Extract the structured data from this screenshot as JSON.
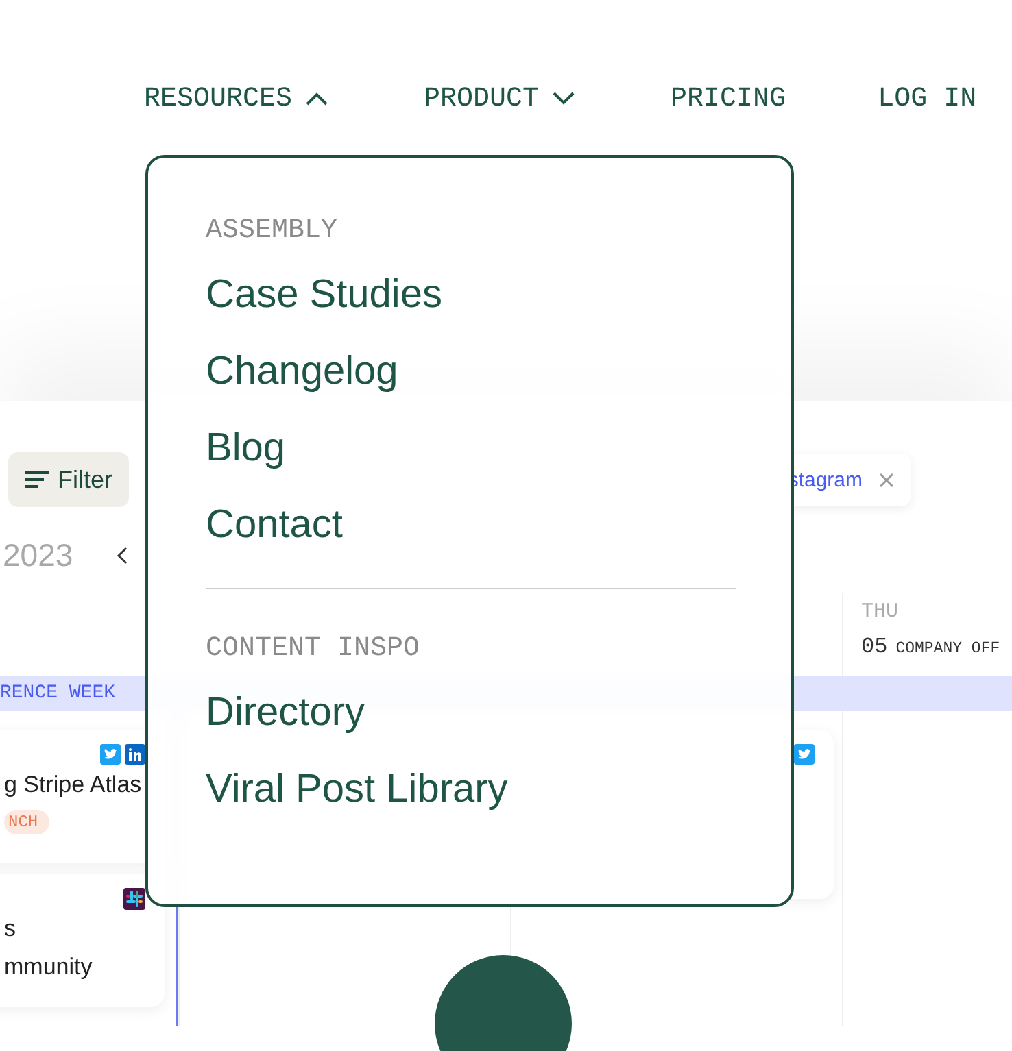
{
  "nav": [
    {
      "label": "RESOURCES",
      "kind": "dropdown",
      "expanded": true
    },
    {
      "label": "PRODUCT",
      "kind": "dropdown",
      "expanded": false
    },
    {
      "label": "PRICING",
      "kind": "link"
    },
    {
      "label": "LOG IN",
      "kind": "link"
    }
  ],
  "menu": {
    "sections": [
      {
        "heading": "ASSEMBLY",
        "items": [
          "Case Studies",
          "Changelog",
          "Blog",
          "Contact"
        ]
      },
      {
        "heading": "CONTENT INSPO",
        "items": [
          "Directory",
          "Viral Post Library"
        ]
      }
    ]
  },
  "calendar": {
    "filter_button": "Filter",
    "chip": "stagram",
    "year": "2023",
    "banner": "RENCE WEEK",
    "day_header": {
      "weekday": "THU",
      "date": "05",
      "event": "COMPANY OFF"
    },
    "cards": [
      {
        "lines": [
          "g Stripe Atlas"
        ],
        "tag": "NCH"
      },
      {
        "lines": [
          "s",
          "mmunity"
        ]
      }
    ]
  }
}
